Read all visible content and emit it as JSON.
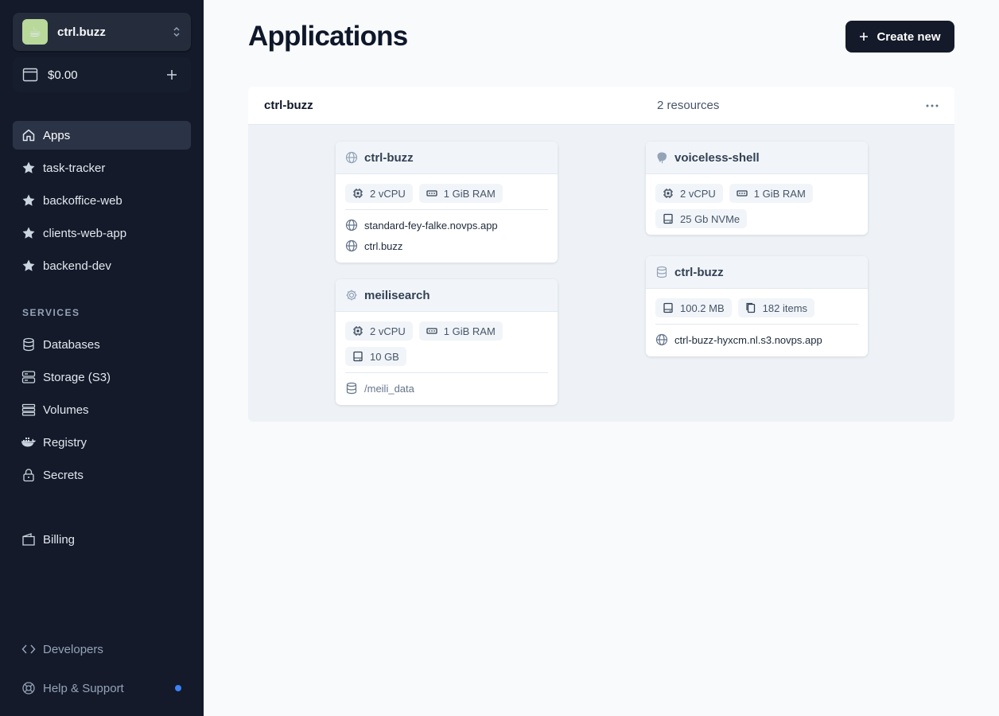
{
  "sidebar": {
    "org": {
      "name": "ctrl.buzz",
      "avatar_emoji": "☕"
    },
    "balance": {
      "amount": "$0.00"
    },
    "nav": [
      {
        "label": "Apps",
        "icon": "home-icon",
        "active": true
      },
      {
        "label": "task-tracker",
        "icon": "star-icon"
      },
      {
        "label": "backoffice-web",
        "icon": "star-icon"
      },
      {
        "label": "clients-web-app",
        "icon": "star-icon"
      },
      {
        "label": "backend-dev",
        "icon": "star-icon"
      }
    ],
    "services_label": "SERVICES",
    "services": [
      {
        "label": "Databases",
        "icon": "database-icon"
      },
      {
        "label": "Storage (S3)",
        "icon": "storage-icon"
      },
      {
        "label": "Volumes",
        "icon": "volumes-icon"
      },
      {
        "label": "Registry",
        "icon": "docker-icon"
      },
      {
        "label": "Secrets",
        "icon": "lock-icon"
      }
    ],
    "billing": {
      "label": "Billing",
      "icon": "wallet-icon"
    },
    "developers": {
      "label": "Developers",
      "icon": "code-icon"
    },
    "help": {
      "label": "Help & Support",
      "icon": "lifebuoy-icon"
    }
  },
  "main": {
    "title": "Applications",
    "create_label": "Create new",
    "project": {
      "name": "ctrl-buzz",
      "count": "2 resources",
      "cards": [
        {
          "title": "ctrl-buzz",
          "icon": "globe-icon",
          "chips": [
            {
              "label": "2 vCPU",
              "icon": "cpu-icon"
            },
            {
              "label": "1 GiB RAM",
              "icon": "ram-icon"
            }
          ],
          "links": [
            "standard-fey-falke.novps.app",
            "ctrl.buzz"
          ]
        },
        {
          "title": "meilisearch",
          "icon": "gear-icon",
          "chips": [
            {
              "label": "2 vCPU",
              "icon": "cpu-icon"
            },
            {
              "label": "1 GiB RAM",
              "icon": "ram-icon"
            },
            {
              "label": "10 GB",
              "icon": "disk-icon"
            }
          ],
          "volume": "/meili_data"
        },
        {
          "title": "voiceless-shell",
          "icon": "postgres-icon",
          "chips": [
            {
              "label": "2 vCPU",
              "icon": "cpu-icon"
            },
            {
              "label": "1 GiB RAM",
              "icon": "ram-icon"
            },
            {
              "label": "25 Gb NVMe",
              "icon": "disk-icon"
            }
          ]
        },
        {
          "title": "ctrl-buzz",
          "icon": "bucket-icon",
          "chips": [
            {
              "label": "100.2 MB",
              "icon": "disk-icon"
            },
            {
              "label": "182 items",
              "icon": "files-icon"
            }
          ],
          "links": [
            "ctrl-buzz-hyxcm.nl.s3.novps.app"
          ]
        }
      ]
    }
  },
  "colors": {
    "sidebar_bg": "#141a29",
    "accent_dot": "#3b82f6",
    "primary_btn": "#141a29"
  }
}
